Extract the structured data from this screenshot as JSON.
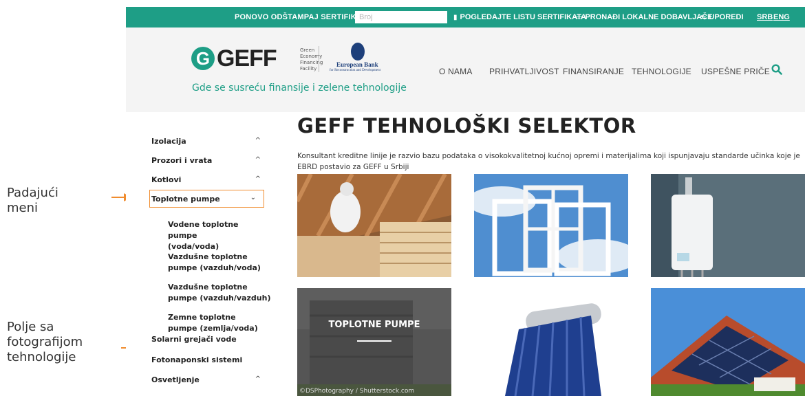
{
  "annotations": {
    "dropdown_label_line1": "Padajući",
    "dropdown_label_line2": "meni",
    "photo_label_line1": "Polje sa",
    "photo_label_line2": "fotografijom",
    "photo_label_line3": "tehnologije",
    "arrow_color": "#f08c2e"
  },
  "topbar": {
    "reprint_label": "PONOVO ODŠTAMPAJ SERTIFIKAT:",
    "number_placeholder": "Broj",
    "view_list_label": "POGLEDAJTE LISTU SERTIFIKATA",
    "local_suppliers_label": "PRONAĐI LOKALNE DOBAVLJAČE",
    "compare_label": "UPOREDI",
    "lang_srb": "SRB",
    "lang_eng": "ENG",
    "color": "#1e9e86"
  },
  "header": {
    "logo_text": "GEFF",
    "logo_sub_1": "Green",
    "logo_sub_2": "Economy",
    "logo_sub_3": "Financing",
    "logo_sub_4": "Facility",
    "partner_name_1": "European Bank",
    "partner_name_2": "for Reconstruction and Development",
    "tagline": "Gde se susreću finansije i zelene tehnologije",
    "nav": [
      "O NAMA",
      "PRIHVATLJIVOST",
      "FINANSIRANJE",
      "TEHNOLOGIJE",
      "USPEŠNE PRIČE"
    ],
    "search_icon": "search-icon"
  },
  "sidebar": {
    "items": [
      {
        "label": "Izolacija",
        "chevron": "^"
      },
      {
        "label": "Prozori i vrata",
        "chevron": "^"
      },
      {
        "label": "Kotlovi",
        "chevron": "^"
      },
      {
        "label": "Toplotne pumpe",
        "chevron": "⌄"
      },
      {
        "label": "Solarni grejači vode",
        "chevron": ""
      },
      {
        "label": "Fotonaponski sistemi",
        "chevron": ""
      },
      {
        "label": "Osvetljenje",
        "chevron": "^"
      }
    ],
    "sub_items": [
      {
        "line1": "Vodene toplotne pumpe",
        "line2": "(voda/voda)"
      },
      {
        "line1": "Vazdušne toplotne",
        "line2": "pumpe (vazduh/voda)"
      },
      {
        "line1": "Vazdušne toplotne",
        "line2": "pumpe (vazduh/vazduh)"
      },
      {
        "line1": "Zemne toplotne",
        "line2": "pumpe (zemlja/voda)"
      }
    ]
  },
  "main": {
    "title": "GEFF TEHNOLOŠKI SELEKTOR",
    "intro": "Konsultant kreditne linije je razvio bazu podataka o visokokvalitetnoj kućnoj opremi i materijalima koji ispunjavaju standarde učinka koje je EBRD postavio za GEFF u Srbiji",
    "hover_tile_label": "TOPLOTNE PUMPE",
    "hover_tile_credit": "©DSPhotography / Shutterstock.com"
  }
}
